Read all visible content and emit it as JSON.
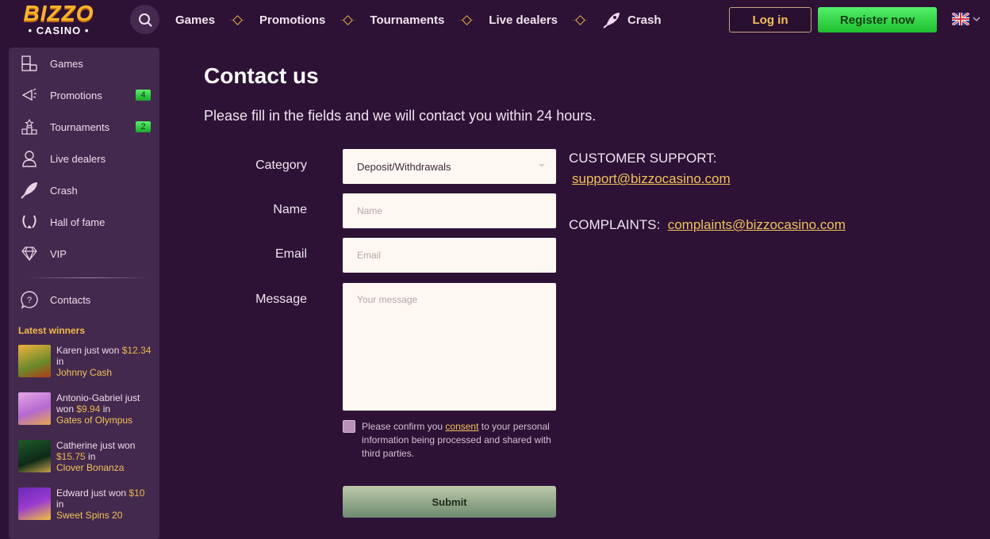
{
  "header": {
    "logo_top": "BIZZO",
    "logo_bottom": "• CASINO •",
    "nav": [
      "Games",
      "Promotions",
      "Tournaments",
      "Live dealers",
      "Crash"
    ],
    "login_label": "Log in",
    "register_label": "Register now",
    "language": "en-GB"
  },
  "sidebar": {
    "items": [
      {
        "label": "Games",
        "icon": "games-icon",
        "badge": null
      },
      {
        "label": "Promotions",
        "icon": "megaphone-icon",
        "badge": "4"
      },
      {
        "label": "Tournaments",
        "icon": "podium-icon",
        "badge": "2"
      },
      {
        "label": "Live dealers",
        "icon": "dealer-icon",
        "badge": null
      },
      {
        "label": "Crash",
        "icon": "rocket-icon",
        "badge": null
      },
      {
        "label": "Hall of fame",
        "icon": "laurel-icon",
        "badge": null
      },
      {
        "label": "VIP",
        "icon": "diamond-icon",
        "badge": null
      },
      {
        "label": "Contacts",
        "icon": "question-bubble-icon",
        "badge": null
      }
    ],
    "latest_winners_title": "Latest winners",
    "winners": [
      {
        "pre": "Karen just won ",
        "amount": "$12.34",
        "post": " in",
        "game": "Johnny Cash"
      },
      {
        "pre": "Antonio-Gabriel just won ",
        "amount": "$9.94",
        "post": " in",
        "game": "Gates of Olympus"
      },
      {
        "pre": "Catherine just won ",
        "amount": "$15.75",
        "post": " in",
        "game": "Clover Bonanza"
      },
      {
        "pre": "Edward just won ",
        "amount": "$10",
        "post": " in",
        "game": "Sweet Spins 20"
      }
    ]
  },
  "main": {
    "title": "Contact us",
    "subtitle": "Please fill in the fields and we will contact you within 24 hours.",
    "form": {
      "category_label": "Category",
      "category_value": "Deposit/Withdrawals",
      "name_label": "Name",
      "name_placeholder": "Name",
      "email_label": "Email",
      "email_placeholder": "Email",
      "message_label": "Message",
      "message_placeholder": "Your message",
      "consent_pre": "Please confirm you ",
      "consent_link": "consent",
      "consent_post": " to your personal information being processed and shared with third parties.",
      "consent_checked": false,
      "submit_label": "Submit"
    },
    "support_label": "CUSTOMER SUPPORT:",
    "support_email": "support@bizzocasino.com",
    "complaints_label": "COMPLAINTS:",
    "complaints_email": "complaints@bizzocasino.com"
  }
}
